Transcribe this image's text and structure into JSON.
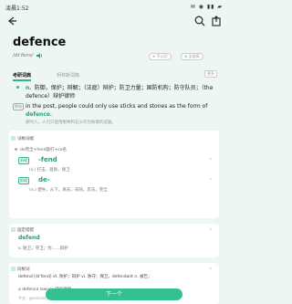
{
  "status_bar": {
    "time": "凌晨1:52",
    "icons": "✉ ◉ ▮▮ ▰"
  },
  "header": {
    "back_icon": "arrow-left-icon",
    "search_icon": "search-icon",
    "export_icon": "export-icon",
    "word": "defence",
    "phonetic": "/dɪˈfens/",
    "speaker_icon": "speaker-icon",
    "chip_1": "⊕ 不认识",
    "chip_2": "⊕ 全部高"
  },
  "tabs": {
    "active": "考研词典",
    "inactive": "柯林斯词典",
    "more": "更多"
  },
  "definition": {
    "pos": "n.",
    "meaning": "防御，保护；辩解；（法庭）辩护；防卫力量；国防机构；防守队员；（the defence）辩护律师",
    "example_tag": "例句",
    "example_en_before": "in the post, people could only use sticks and stones as the form of ",
    "example_en_highlight": "defence",
    "example_en_after": ".",
    "example_cn": "那时人，人们只能用棍棒和石头作为防御的武器。"
  },
  "card_etymology": {
    "title": "词根词缀",
    "intro": "de完全+fend敲打+ce名",
    "prefix_tag_1": "前缀",
    "root_1": "-fend",
    "desc_1": "(v.) 打击，驱除，保卫",
    "prefix_tag_2": "前缀",
    "root_2": "de-",
    "desc_2": "(n.) 使失，从下，离去，去除，反向，完全"
  },
  "card_phrase": {
    "title": "固定搭配",
    "phrase": "defend",
    "meaning": "v. 防卫，守卫；为……辩护"
  },
  "card_related": {
    "title": "同根词",
    "line_1": "defend [dɪˈfend] vt. 防护；辩护 vi. 防守；保卫。defendant n. 被告；",
    "line_2": "a defence lawyer 辩护律师",
    "line_3": "专业：generosity"
  },
  "next_button": "下一个"
}
